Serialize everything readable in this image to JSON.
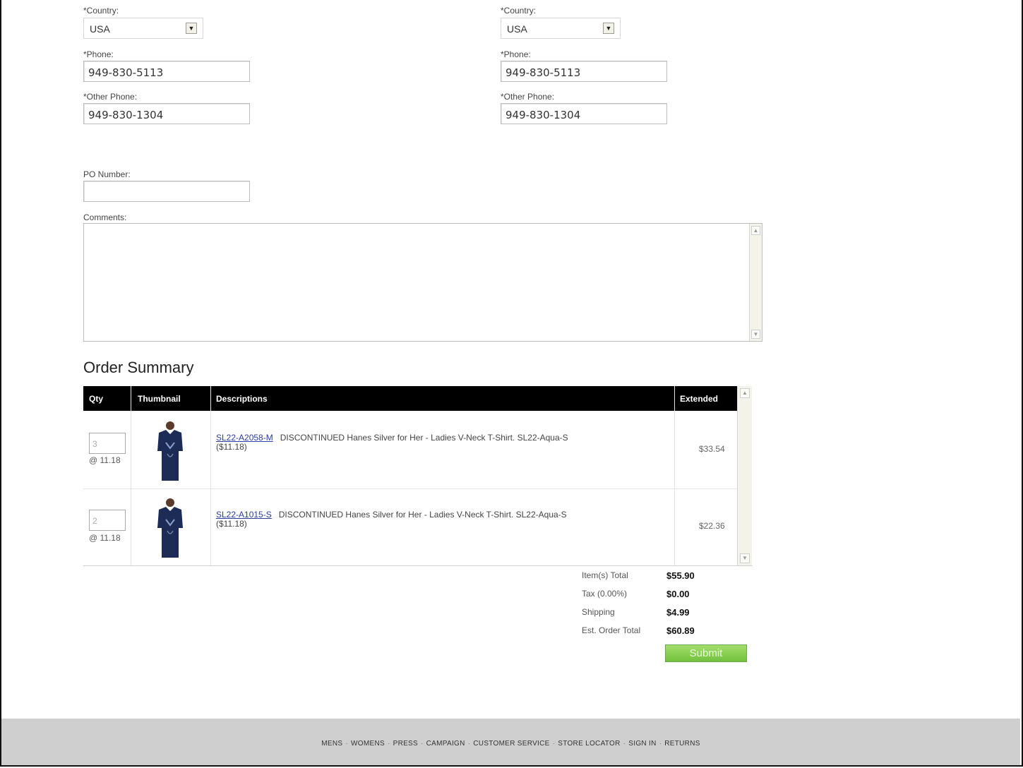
{
  "billing": {
    "country_label": "*Country:",
    "country_value": "USA",
    "phone_label": "*Phone:",
    "phone_value": "949-830-5113",
    "other_phone_label": "*Other Phone:",
    "other_phone_value": "949-830-1304"
  },
  "shipping": {
    "country_label": "*Country:",
    "country_value": "USA",
    "phone_label": "*Phone:",
    "phone_value": "949-830-5113",
    "other_phone_label": "*Other Phone:",
    "other_phone_value": "949-830-1304"
  },
  "po": {
    "label": "PO Number:",
    "value": ""
  },
  "comments": {
    "label": "Comments:",
    "value": ""
  },
  "order_summary": {
    "title": "Order Summary",
    "columns": [
      "Qty",
      "Thumbnail",
      "Descriptions",
      "Extended"
    ],
    "items": [
      {
        "qty": "3",
        "unit_price": "@ 11.18",
        "sku": "SL22-A2058-M",
        "description": "DISCONTINUED Hanes Silver for Her - Ladies V-Neck T-Shirt. SL22-Aqua-S",
        "price_note": "($11.18)",
        "extended": "$33.54"
      },
      {
        "qty": "2",
        "unit_price": "@ 11.18",
        "sku": "SL22-A1015-S",
        "description": "DISCONTINUED Hanes Silver for Her - Ladies V-Neck T-Shirt. SL22-Aqua-S",
        "price_note": "($11.18)",
        "extended": "$22.36"
      }
    ]
  },
  "totals": {
    "item_total_label": "Item(s) Total",
    "item_total_value": "$55.90",
    "tax_label": "Tax (0.00%)",
    "tax_value": "$0.00",
    "shipping_label": "Shipping",
    "shipping_value": "$4.99",
    "order_total_label": "Est. Order Total",
    "order_total_value": "$60.89"
  },
  "submit_label": "Submit",
  "footer": {
    "links": [
      "MENS",
      "WOMENS",
      "PRESS",
      "CAMPAIGN",
      "CUSTOMER SERVICE",
      "STORE LOCATOR",
      "SIGN IN",
      "RETURNS"
    ],
    "separator": "·"
  },
  "colors": {
    "header_bg": "#000000",
    "submit_green": "#7cc644",
    "footer_bg": "#cfcfcf",
    "link_blue": "#2a3d9e"
  }
}
